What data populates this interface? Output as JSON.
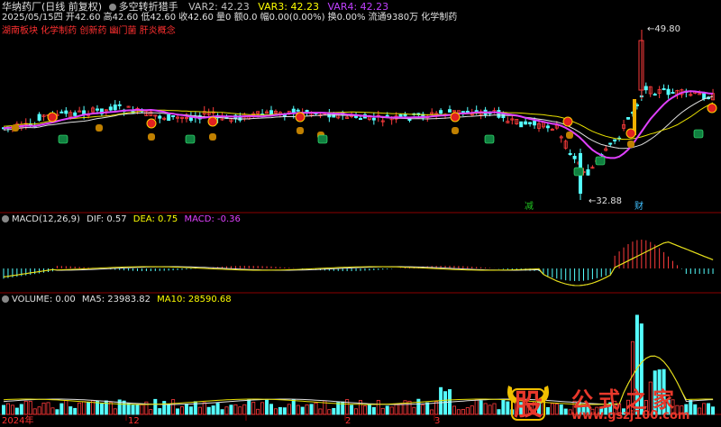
{
  "header": {
    "title": "华纳药厂(日线 前复权)",
    "indicator_name": "多空转折猎手",
    "vars": [
      {
        "label": "VAR2: 42.23",
        "color": "#c0c0c0"
      },
      {
        "label": "VAR3: 42.23",
        "color": "#ffff00"
      },
      {
        "label": "VAR4: 42.23",
        "color": "#c040ff"
      }
    ],
    "quote_line": "2025/05/15四 开42.60 高42.60 低42.60 收42.60 量0 额0.0 幅0.00(0.00%) 换0.00% 流通9380万 化学制药",
    "sectors": "湖南板块 化学制药 创新药 幽门菌 肝炎概念"
  },
  "price_labels": {
    "high": "49.80",
    "low": "32.88"
  },
  "signals": {
    "reduce": "减",
    "wealth": "财",
    "buy_green": "买"
  },
  "macd": {
    "name": "MACD(12,26,9)",
    "dif_label": "DIF: 0.57",
    "dea_label": "DEA: 0.75",
    "macd_label": "MACD: -0.36"
  },
  "volume": {
    "name": "VOLUME: 0.00",
    "ma5_label": "MA5: 23983.82",
    "ma10_label": "MA10: 28590.68"
  },
  "x_axis": [
    "2024年",
    "12",
    "2",
    "3"
  ],
  "watermark": {
    "badge": "股",
    "name": "公式之家",
    "url": "www.gszj100.com"
  },
  "colors": {
    "up": "#ff3c3c",
    "down": "#54ffff",
    "ma_purple": "#e040ff",
    "ma_white": "#e0e0e0",
    "ma_yellow": "#e8e000",
    "divider": "#8b0000"
  }
}
